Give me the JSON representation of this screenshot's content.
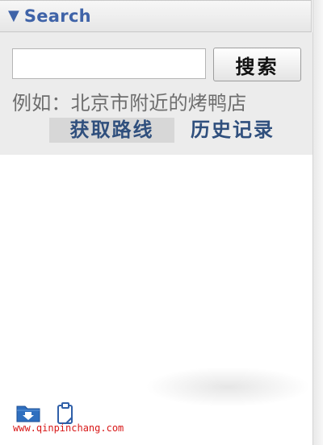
{
  "header": {
    "arrow": "▼",
    "title": "Search"
  },
  "search": {
    "value": "",
    "placeholder": "",
    "button_label": "搜索",
    "example_text": "例如：北京市附近的烤鸭店"
  },
  "links": {
    "get_route": "获取路线",
    "history": "历史记录"
  },
  "toolbar": {
    "icons": [
      "folder-download-icon",
      "clipboard-icon"
    ]
  },
  "watermark": "www.qinpinchang.com",
  "colors": {
    "accent": "#3f63a8",
    "link": "#2f4f7d",
    "panel_bg": "#ececec",
    "watermark": "#d81818"
  }
}
